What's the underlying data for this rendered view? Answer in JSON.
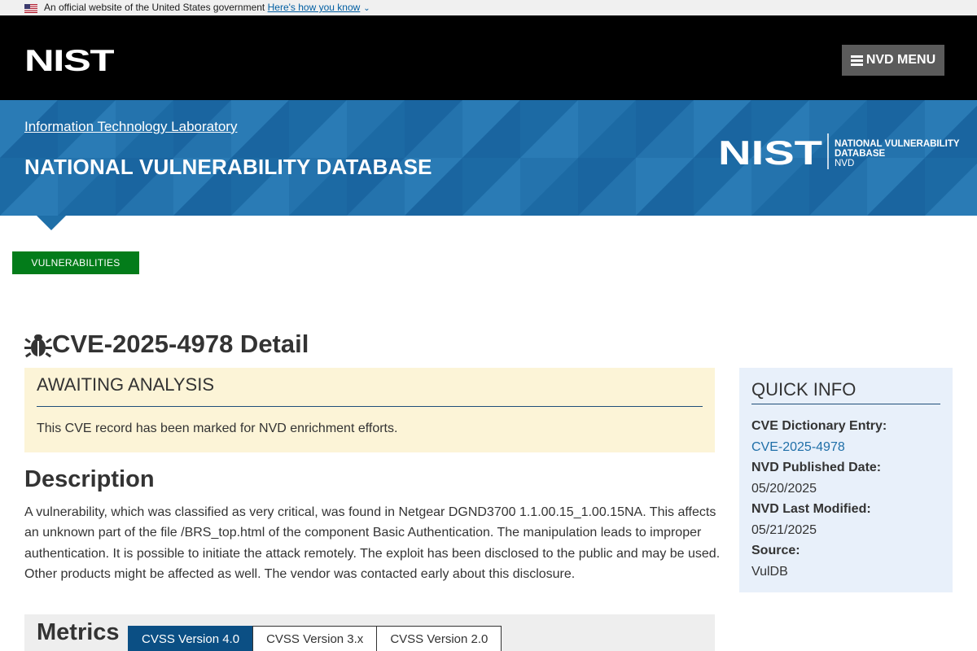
{
  "gov_banner": {
    "text": "An official website of the United States government",
    "link": "Here's how you know"
  },
  "header": {
    "logo": "NIST",
    "menu_label": "NVD MENU"
  },
  "banner": {
    "itl_link": "Information Technology Laboratory",
    "title": "NATIONAL VULNERABILITY DATABASE",
    "logo_wordmark": "NIST",
    "logo_line1": "NATIONAL VULNERABILITY",
    "logo_line2": "DATABASE",
    "logo_line3": "NVD"
  },
  "nav": {
    "tag": "VULNERABILITIES"
  },
  "page": {
    "title": "CVE-2025-4978 Detail"
  },
  "awaiting": {
    "title": "AWAITING ANALYSIS",
    "text": "This CVE record has been marked for NVD enrichment efforts."
  },
  "description": {
    "heading": "Description",
    "text": "A vulnerability, which was classified as very critical, was found in Netgear DGND3700 1.1.00.15_1.00.15NA. This affects an unknown part of the file /BRS_top.html of the component Basic Authentication. The manipulation leads to improper authentication. It is possible to initiate the attack remotely. The exploit has been disclosed to the public and may be used. Other products might be affected as well. The vendor was contacted early about this disclosure."
  },
  "quick_info": {
    "title": "QUICK INFO",
    "items": [
      {
        "label": "CVE Dictionary Entry:",
        "value": "CVE-2025-4978"
      },
      {
        "label": "NVD Published Date:",
        "value": "05/20/2025"
      },
      {
        "label": "NVD Last Modified:",
        "value": "05/21/2025"
      },
      {
        "label": "Source:",
        "value": "VulDB"
      }
    ]
  },
  "metrics": {
    "heading": "Metrics",
    "tabs": [
      "CVSS Version 4.0",
      "CVSS Version 3.x",
      "CVSS Version 2.0"
    ],
    "active_tab": "CVSS Version 4.0"
  },
  "colors": {
    "header_bg": "#000000",
    "banner_blue": "#1f6fa8",
    "vuln_green": "#037c1a",
    "await_bg": "#fcf4d7",
    "quickinfo_bg": "#e8f0fa",
    "active_tab": "#0b4f84"
  },
  "icons": [
    "us-flag-icon",
    "chevron-down-icon",
    "hamburger-icon",
    "bug-icon"
  ]
}
